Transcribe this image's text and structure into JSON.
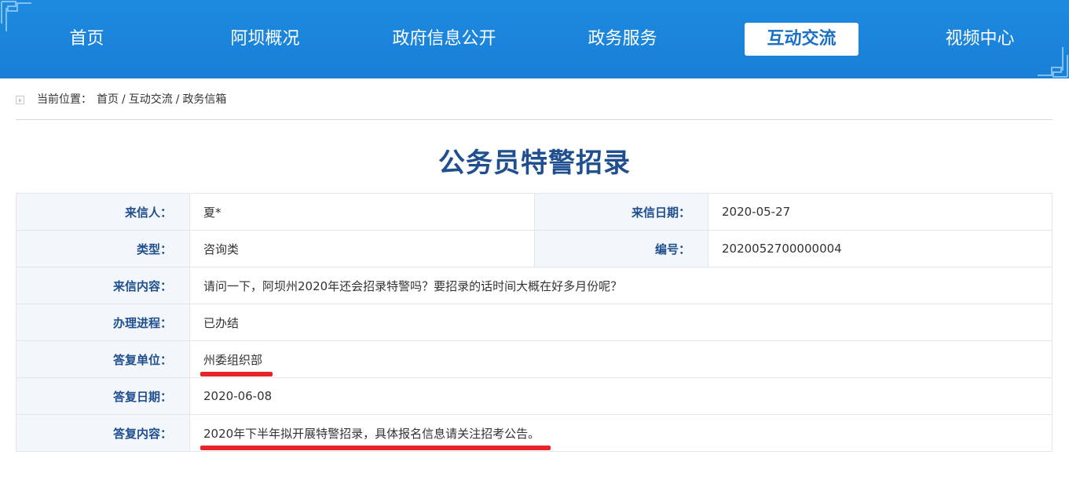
{
  "nav": {
    "items": [
      {
        "label": "首页"
      },
      {
        "label": "阿坝概况"
      },
      {
        "label": "政府信息公开"
      },
      {
        "label": "政务服务"
      },
      {
        "label": "互动交流"
      },
      {
        "label": "视频中心"
      }
    ],
    "active_index": 4,
    "color": "#1a7fd6"
  },
  "breadcrumb": {
    "prefix": "当前位置：",
    "items": [
      "首页",
      "互动交流",
      "政务信箱"
    ],
    "separator": "/"
  },
  "page": {
    "title": "公务员特警招录"
  },
  "letter": {
    "sender_label": "来信人：",
    "sender": "夏*",
    "date_label": "来信日期：",
    "date": "2020-05-27",
    "type_label": "类型：",
    "type": "咨询类",
    "number_label": "编号：",
    "number": "2020052700000004",
    "content_label": "来信内容：",
    "content": "请问一下，阿坝州2020年还会招录特警吗？要招录的话时间大概在好多月份呢？",
    "progress_label": "办理进程：",
    "progress": "已办结",
    "reply_unit_label": "答复单位：",
    "reply_unit": "州委组织部",
    "reply_date_label": "答复日期：",
    "reply_date": "2020-06-08",
    "reply_content_label": "答复内容：",
    "reply_content": "2020年下半年拟开展特警招录，具体报名信息请关注招考公告。"
  },
  "colors": {
    "accent": "#1f4f8f",
    "highlight": "#e8232a",
    "label_bg": "#f3f6fa"
  }
}
